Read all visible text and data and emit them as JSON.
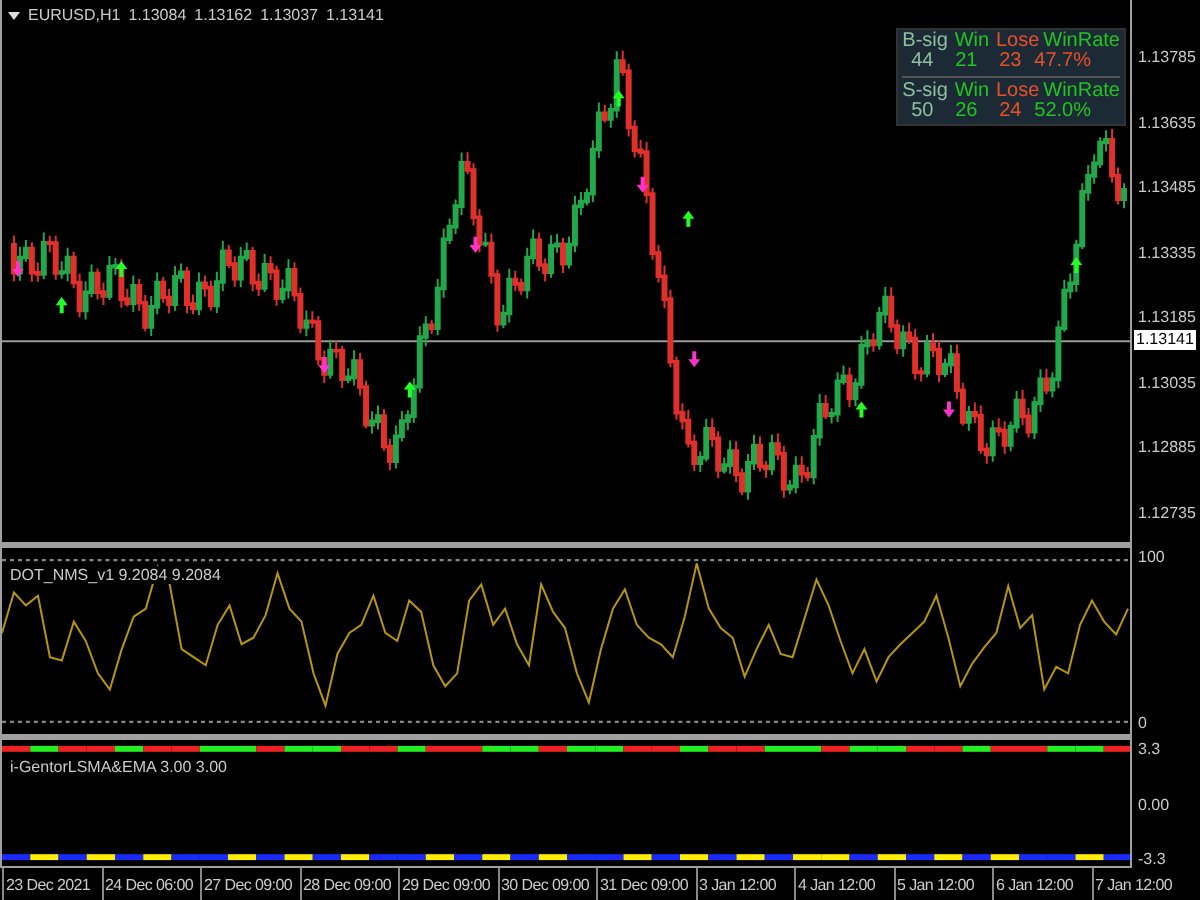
{
  "chart": {
    "symbol": "EURUSD,H1",
    "quotes": [
      "1.13084",
      "1.13162",
      "1.13037",
      "1.13141"
    ],
    "stats": [
      {
        "cells": [
          {
            "text": "B-sig",
            "color": "#8fbfa0"
          },
          {
            "text": "Win",
            "color": "#22c322"
          },
          {
            "text": "Lose",
            "color": "#e8502a"
          },
          {
            "text": "WinRate",
            "color": "#22c322"
          }
        ]
      },
      {
        "cells": [
          {
            "text": "44",
            "color": "#8fbfa0"
          },
          {
            "text": "21",
            "color": "#22c322"
          },
          {
            "text": "23",
            "color": "#e8502a"
          },
          {
            "text": "47.7%",
            "color": "#e8502a"
          }
        ]
      },
      {
        "cells": [
          {
            "text": "S-sig",
            "color": "#8fbfa0"
          },
          {
            "text": "Win",
            "color": "#22c322"
          },
          {
            "text": "Lose",
            "color": "#e8502a"
          },
          {
            "text": "WinRate",
            "color": "#22c322"
          }
        ]
      },
      {
        "cells": [
          {
            "text": "50",
            "color": "#8fbfa0"
          },
          {
            "text": "26",
            "color": "#22c322"
          },
          {
            "text": "24",
            "color": "#e8502a"
          },
          {
            "text": "52.0%",
            "color": "#22c322"
          }
        ]
      }
    ],
    "price_axis": [
      "1.13785",
      "1.13635",
      "1.13485",
      "1.13335",
      "1.13185",
      "1.13035",
      "1.12885",
      "1.12735"
    ],
    "current_price": "1.13141"
  },
  "oscillator": {
    "title": "DOT_NMS_v1 9.2084 9.2084",
    "chart_data": {
      "type": "line",
      "ylim": [
        0,
        100
      ],
      "yticks": [
        {
          "value": 100,
          "label": "100"
        },
        {
          "value": 0,
          "label": "0"
        }
      ],
      "series": [
        {
          "color": "#b8960b",
          "values": [
            55,
            80,
            72,
            78,
            40,
            38,
            62,
            50,
            30,
            20,
            45,
            65,
            70,
            96,
            85,
            45,
            40,
            35,
            60,
            72,
            48,
            52,
            66,
            92,
            70,
            62,
            30,
            10,
            42,
            55,
            60,
            78,
            55,
            50,
            75,
            68,
            35,
            22,
            30,
            75,
            85,
            60,
            70,
            48,
            35,
            85,
            68,
            58,
            30,
            12,
            45,
            70,
            82,
            60,
            52,
            48,
            40,
            65,
            98,
            70,
            58,
            52,
            28,
            45,
            60,
            42,
            40,
            64,
            88,
            72,
            50,
            30,
            45,
            25,
            40,
            48,
            55,
            62,
            78,
            52,
            22,
            36,
            46,
            55,
            84,
            58,
            66,
            20,
            34,
            30,
            60,
            75,
            62,
            54,
            70
          ]
        }
      ]
    }
  },
  "trend_indicator": {
    "title": "i-GentorLSMA&EMA 3.00 3.00",
    "axis": [
      "3.3",
      "0.00",
      "-3.3"
    ]
  },
  "time_axis": [
    "23 Dec 2021",
    "24 Dec 06:00",
    "27 Dec 09:00",
    "28 Dec 09:00",
    "29 Dec 09:00",
    "30 Dec 09:00",
    "31 Dec 09:00",
    "3 Jan 12:00",
    "4 Jan 12:00",
    "5 Jan 12:00",
    "6 Jan 12:00",
    "7 Jan 12:00"
  ]
}
